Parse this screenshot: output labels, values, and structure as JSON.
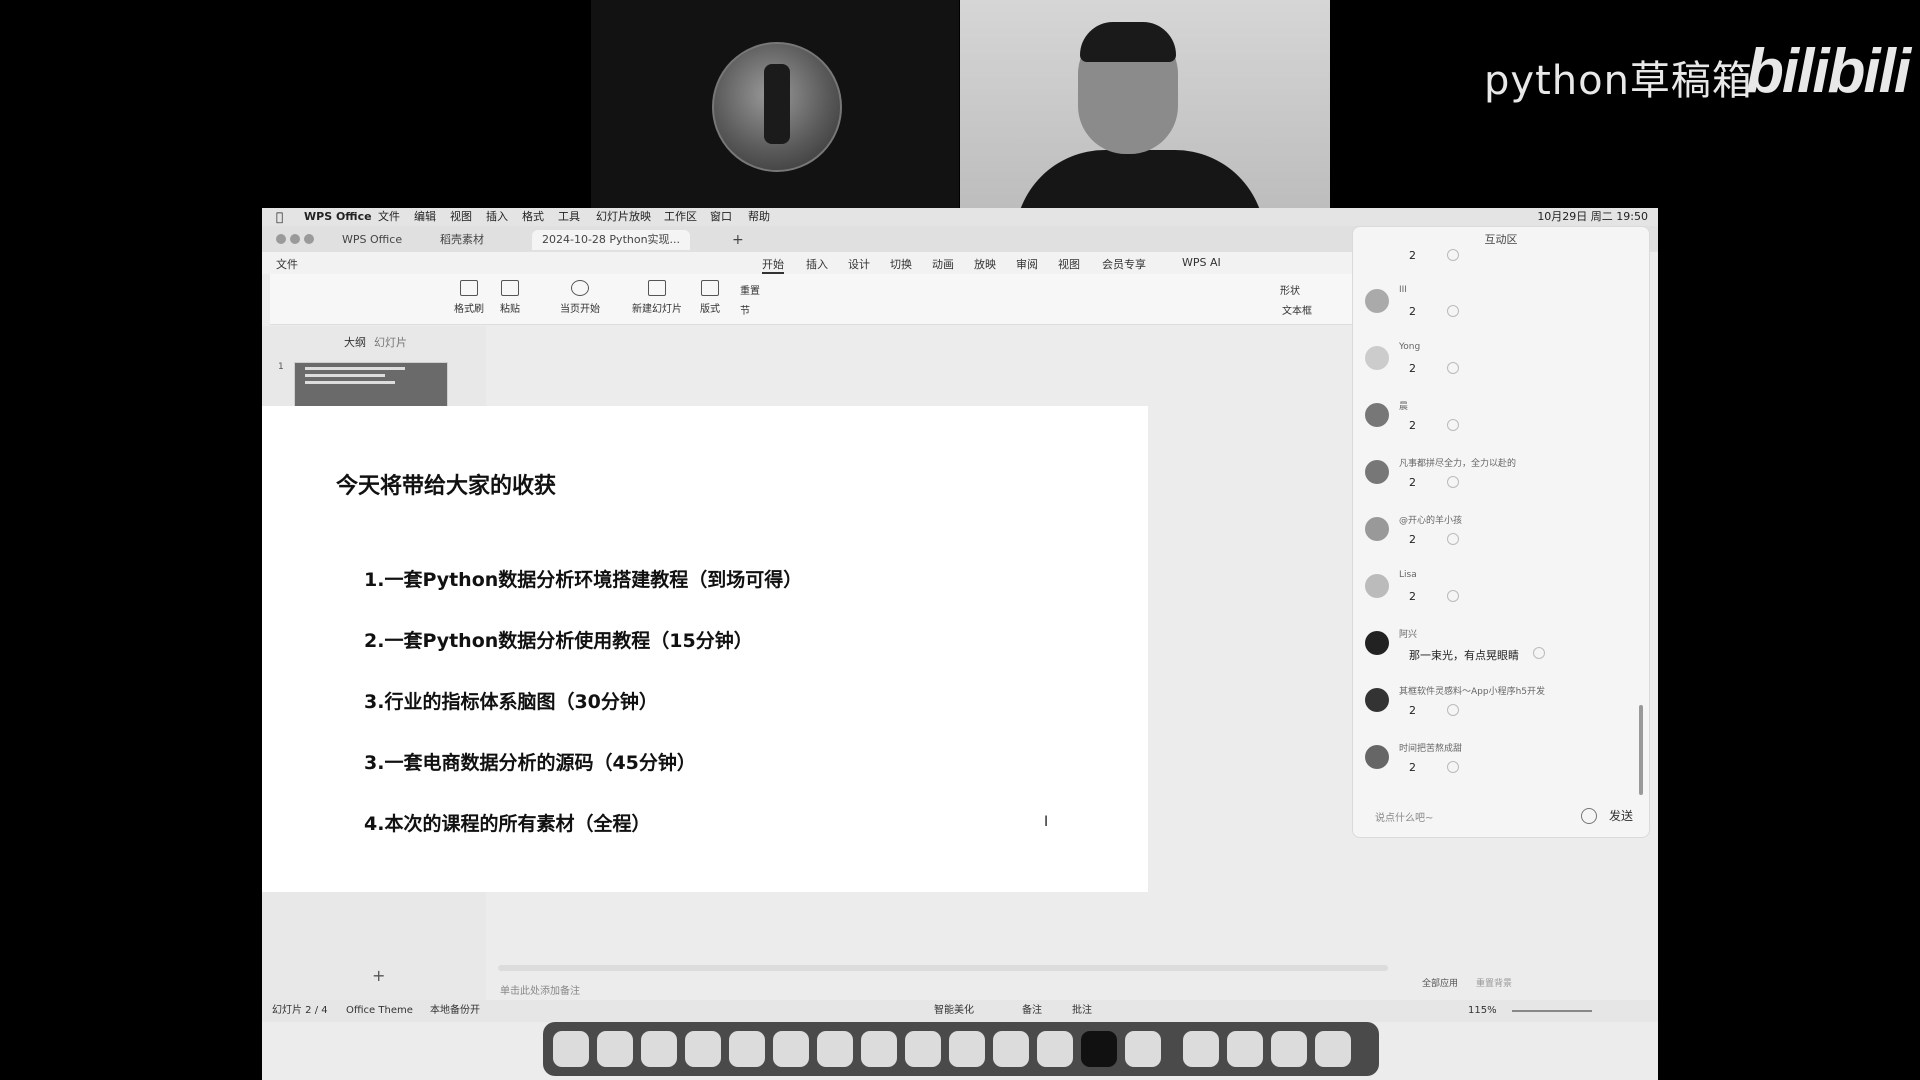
{
  "overlay": {
    "watermark_text": "python草稿箱",
    "watermark_logo": "bilibili"
  },
  "menubar": {
    "app": "WPS Office",
    "items": [
      "文件",
      "编辑",
      "视图",
      "插入",
      "格式",
      "工具",
      "幻灯片放映",
      "工作区",
      "窗口",
      "帮助"
    ],
    "datetime": "10月29日 周二 19:50"
  },
  "tabs": [
    {
      "label": "WPS Office"
    },
    {
      "label": "稻壳素材"
    },
    {
      "label": "2024-10-28 Python实现..."
    }
  ],
  "ribbon_tabs": [
    "开始",
    "插入",
    "设计",
    "切换",
    "动画",
    "放映",
    "审阅",
    "视图",
    "会员专享",
    "WPS AI"
  ],
  "file_menu": "文件",
  "ribbon_buttons": [
    "格式刷",
    "粘贴",
    "当页开始",
    "新建幻灯片",
    "版式",
    "节",
    "重置",
    "形状",
    "文本框"
  ],
  "panel": {
    "outline_tab": "大纲",
    "slides_tab": "幻灯片"
  },
  "slide": {
    "title": "今天将带给大家的收获",
    "items": [
      "1.一套Python数据分析环境搭建教程（到场可得）",
      "2.一套Python数据分析使用教程（15分钟）",
      "3.行业的指标体系脑图（30分钟）",
      "3.一套电商数据分析的源码（45分钟）",
      "4.本次的课程的所有素材（全程）"
    ]
  },
  "notes_placeholder": "单击此处添加备注",
  "status": {
    "slide_count": "幻灯片 2 / 4",
    "theme": "Office Theme",
    "backup": "本地备份开",
    "beautify": "智能美化",
    "notes": "备注",
    "comments": "批注",
    "zoom": "115%",
    "apply_all": "全部应用",
    "reset_bg": "重置背景"
  },
  "chat": {
    "header": "互动区",
    "messages": [
      {
        "name": "",
        "text": "2"
      },
      {
        "name": "III",
        "text": "2"
      },
      {
        "name": "Yong",
        "text": "2"
      },
      {
        "name": "晨",
        "text": "2"
      },
      {
        "name": "凡事都拼尽全力，全力以赴的",
        "text": "2"
      },
      {
        "name": "@开心的羊小孩",
        "text": "2"
      },
      {
        "name": "Lisa",
        "text": "2"
      },
      {
        "name": "阿兴",
        "text": "那一束光，有点晃眼睛"
      },
      {
        "name": "其框软件灵感料～App小程序h5开发",
        "text": "2"
      },
      {
        "name": "时间把苦熬成甜",
        "text": "2"
      }
    ],
    "input_placeholder": "说点什么吧~",
    "send_label": "发送"
  }
}
